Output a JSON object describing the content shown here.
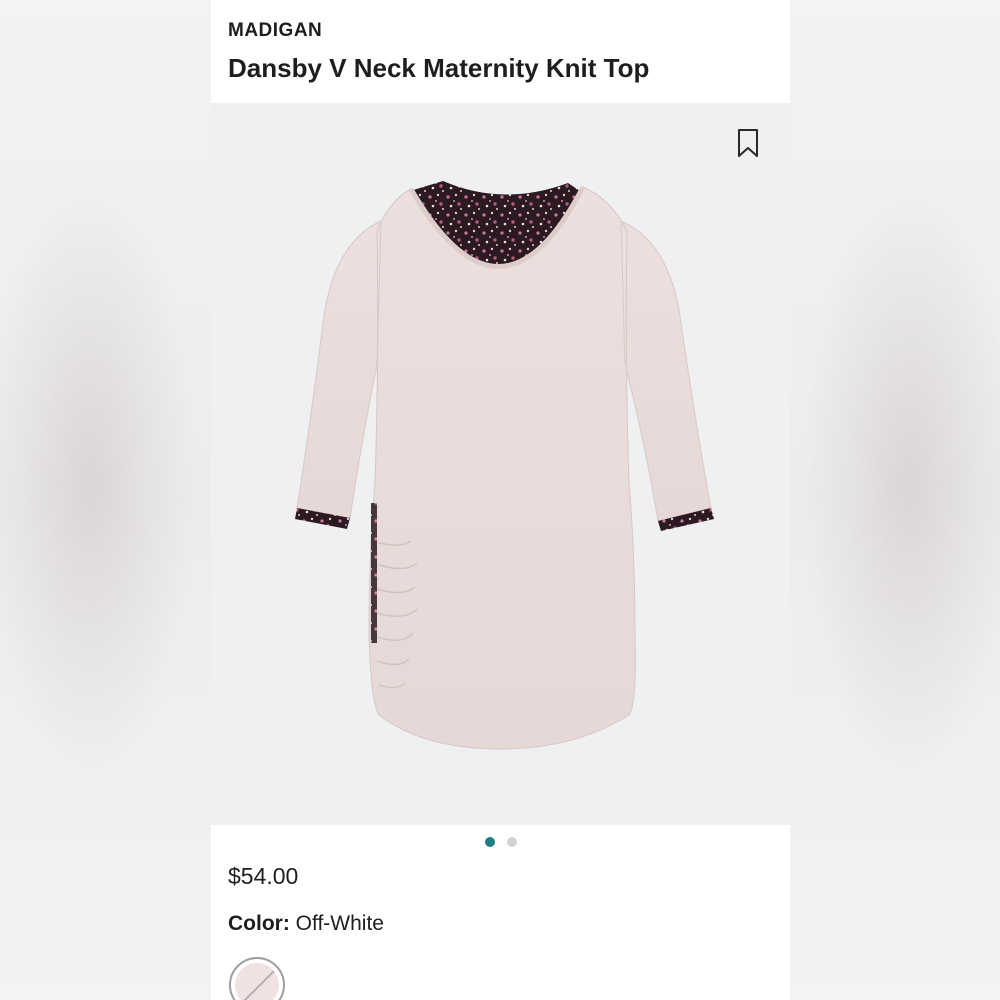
{
  "product": {
    "brand": "MADIGAN",
    "title": "Dansby V Neck Maternity Knit Top",
    "price": "$54.00",
    "color_label": "Color:",
    "color_value": "Off-White"
  },
  "gallery": {
    "image_count": 2,
    "active_index": 0,
    "bookmark_icon": "bookmark-icon"
  },
  "colors": {
    "active_dot": "#1f7f86",
    "inactive_dot": "#cfd3d6",
    "image_background": "#eff0f2",
    "garment": "#e8dad8",
    "print_base": "#2b1a22"
  }
}
